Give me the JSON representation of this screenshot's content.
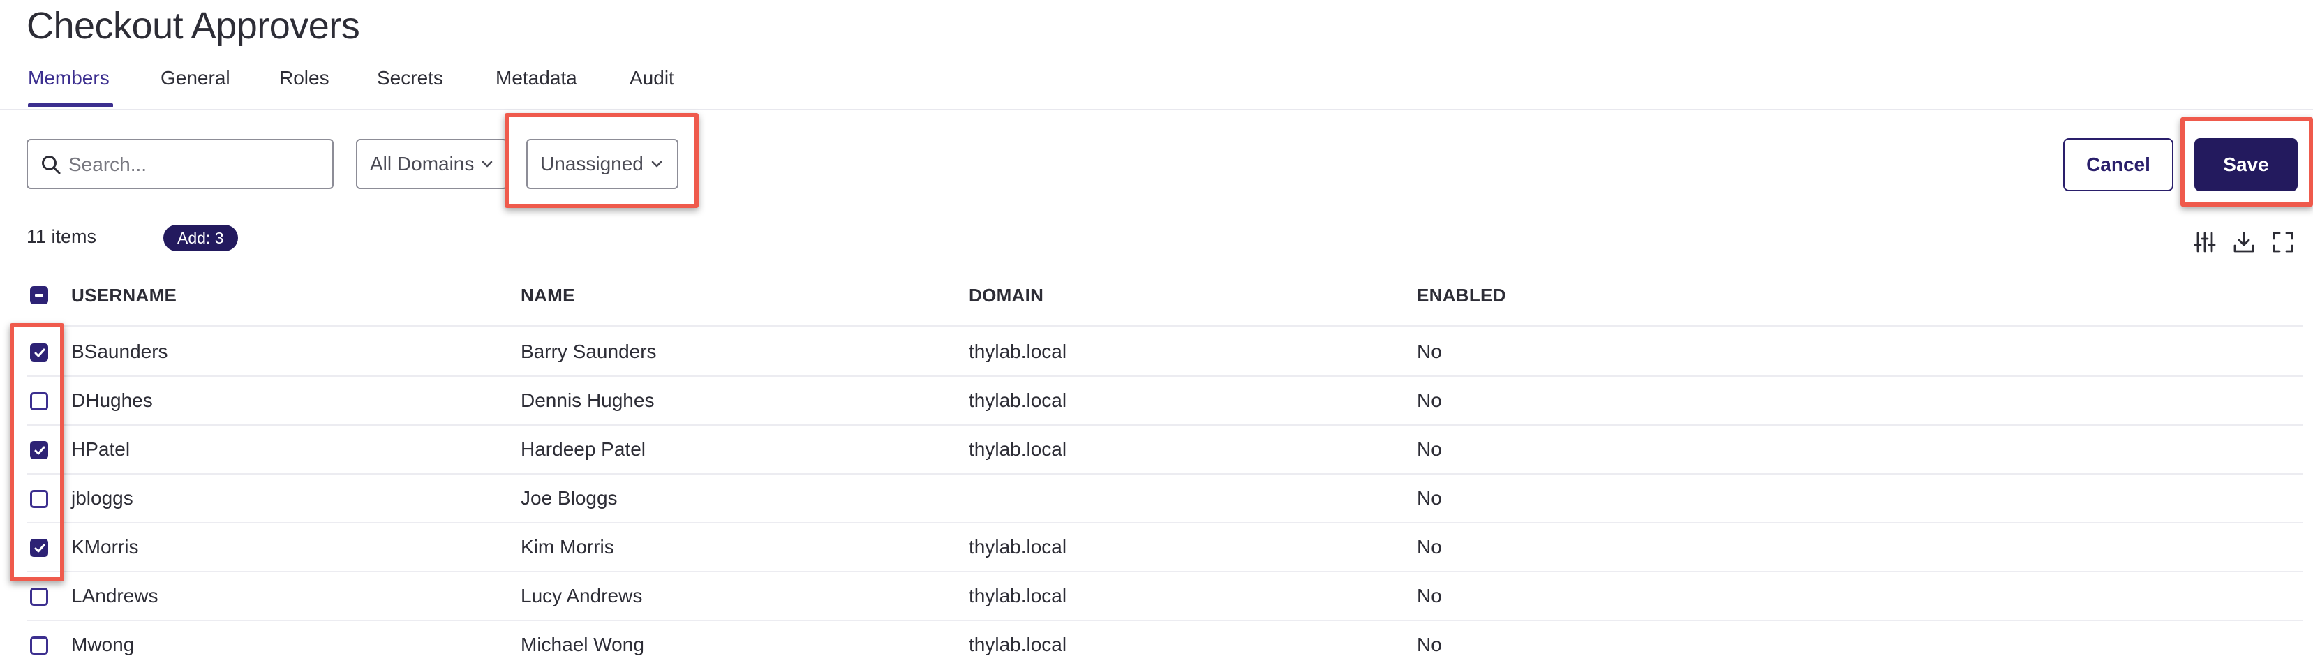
{
  "page": {
    "title": "Checkout Approvers"
  },
  "tabs": [
    {
      "label": "Members",
      "active": true
    },
    {
      "label": "General",
      "active": false
    },
    {
      "label": "Roles",
      "active": false
    },
    {
      "label": "Secrets",
      "active": false
    },
    {
      "label": "Metadata",
      "active": false
    },
    {
      "label": "Audit",
      "active": false
    }
  ],
  "toolbar": {
    "search_placeholder": "Search...",
    "domain_filter": "All Domains",
    "assignment_filter": "Unassigned",
    "cancel_label": "Cancel",
    "save_label": "Save"
  },
  "summary": {
    "items_count": "11 items",
    "add_badge": "Add: 3"
  },
  "table": {
    "columns": [
      "USERNAME",
      "NAME",
      "DOMAIN",
      "ENABLED"
    ],
    "rows": [
      {
        "checked": true,
        "username": "BSaunders",
        "name": "Barry Saunders",
        "domain": "thylab.local",
        "enabled": "No"
      },
      {
        "checked": false,
        "username": "DHughes",
        "name": "Dennis Hughes",
        "domain": "thylab.local",
        "enabled": "No"
      },
      {
        "checked": true,
        "username": "HPatel",
        "name": "Hardeep Patel",
        "domain": "thylab.local",
        "enabled": "No"
      },
      {
        "checked": false,
        "username": "jbloggs",
        "name": "Joe Bloggs",
        "domain": "",
        "enabled": "No"
      },
      {
        "checked": true,
        "username": "KMorris",
        "name": "Kim Morris",
        "domain": "thylab.local",
        "enabled": "No"
      },
      {
        "checked": false,
        "username": "LAndrews",
        "name": "Lucy Andrews",
        "domain": "thylab.local",
        "enabled": "No"
      },
      {
        "checked": false,
        "username": "Mwong",
        "name": "Michael Wong",
        "domain": "thylab.local",
        "enabled": "No"
      }
    ]
  },
  "icons": [
    "search-icon",
    "chevron-down-icon",
    "column-settings-icon",
    "download-icon",
    "fullscreen-icon",
    "checkmark-icon"
  ],
  "colors": {
    "accent": "#231a5e",
    "annotation": "#ef5a4c"
  }
}
